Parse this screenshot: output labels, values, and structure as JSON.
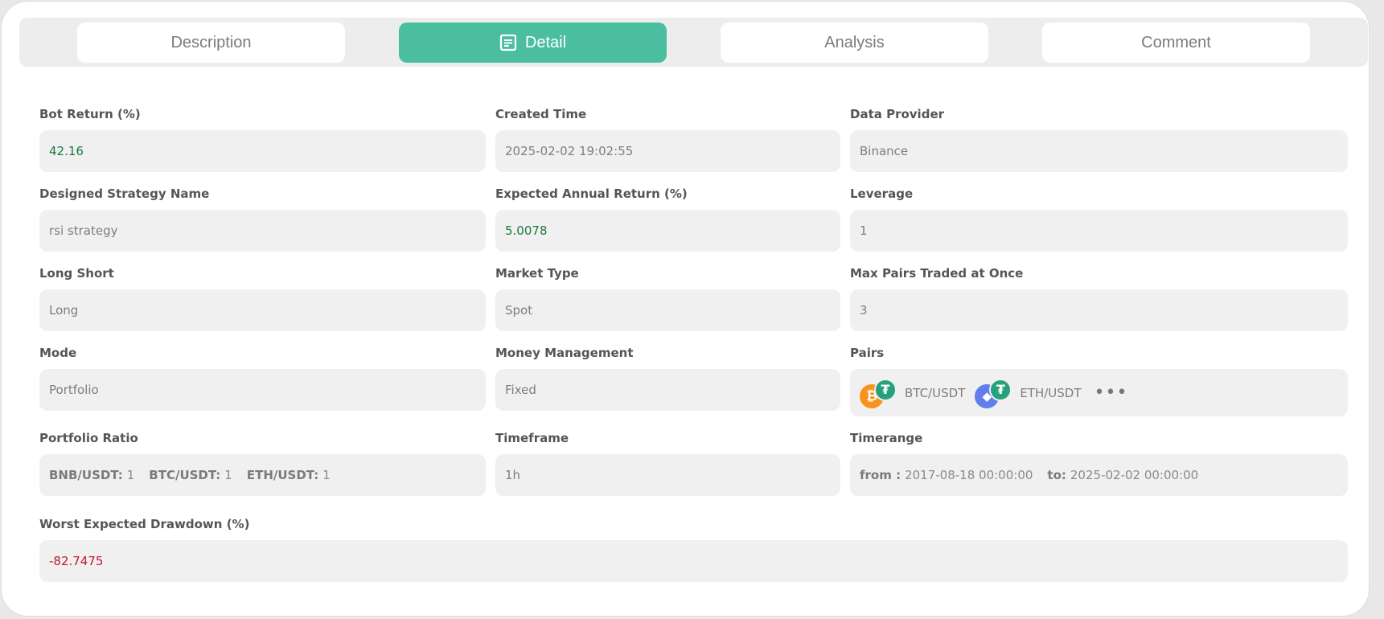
{
  "tabs": [
    {
      "label": "Description"
    },
    {
      "label": "Detail"
    },
    {
      "label": "Analysis"
    },
    {
      "label": "Comment"
    }
  ],
  "fields": {
    "bot_return": {
      "label": "Bot Return (%)",
      "value": "42.16"
    },
    "created_time": {
      "label": "Created Time",
      "value": "2025-02-02 19:02:55"
    },
    "data_provider": {
      "label": "Data Provider",
      "value": "Binance"
    },
    "strategy_name": {
      "label": "Designed Strategy Name",
      "value": "rsi strategy"
    },
    "expected_annual_return": {
      "label": "Expected Annual Return (%)",
      "value": "5.0078"
    },
    "leverage": {
      "label": "Leverage",
      "value": "1"
    },
    "long_short": {
      "label": "Long Short",
      "value": "Long"
    },
    "market_type": {
      "label": "Market Type",
      "value": "Spot"
    },
    "max_pairs": {
      "label": "Max Pairs Traded at Once",
      "value": "3"
    },
    "mode": {
      "label": "Mode",
      "value": "Portfolio"
    },
    "money_management": {
      "label": "Money Management",
      "value": "Fixed"
    },
    "pairs": {
      "label": "Pairs",
      "items": [
        {
          "name": "BTC/USDT",
          "base_symbol": "₿",
          "quote_symbol": "₮"
        },
        {
          "name": "ETH/USDT",
          "base_symbol": "◆",
          "quote_symbol": "₮"
        }
      ],
      "more": "•••"
    },
    "portfolio_ratio": {
      "label": "Portfolio Ratio",
      "items": [
        {
          "key": "BNB/USDT:",
          "value": "1"
        },
        {
          "key": "BTC/USDT:",
          "value": "1"
        },
        {
          "key": "ETH/USDT:",
          "value": "1"
        }
      ]
    },
    "timeframe": {
      "label": "Timeframe",
      "value": "1h"
    },
    "timerange": {
      "label": "Timerange",
      "from_label": "from :",
      "from_value": "2017-08-18 00:00:00",
      "to_label": "to:",
      "to_value": "2025-02-02 00:00:00"
    },
    "worst_drawdown": {
      "label": "Worst Expected Drawdown (%)",
      "value": "-82.7475"
    }
  },
  "icons": {
    "detail_tab": "document-icon",
    "btc": "bitcoin-icon",
    "eth": "ethereum-icon",
    "usdt": "tether-icon"
  },
  "colors": {
    "accent": "#4cbea0",
    "positive": "#1a7a3a",
    "negative": "#c0182b",
    "btc": "#f7931a",
    "eth": "#627eea",
    "usdt": "#26a17b"
  }
}
